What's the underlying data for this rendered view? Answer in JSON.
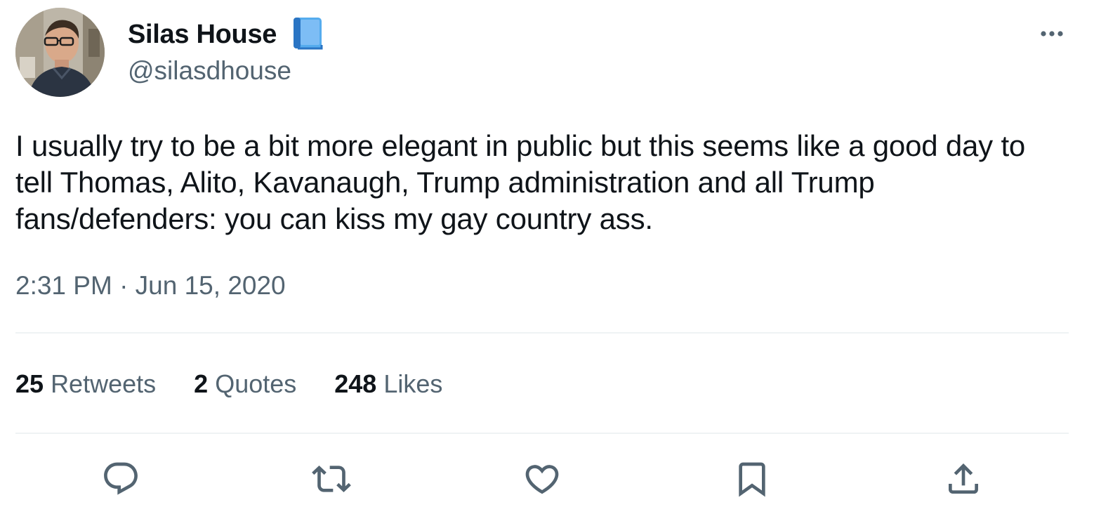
{
  "author": {
    "display_name": "Silas House",
    "handle": "@silasdhouse",
    "badge_icon": "blue-book-emoji",
    "avatar_icon": "profile-photo"
  },
  "tweet": {
    "text": "I usually try to be a bit more elegant in public but this seems like a good day to tell Thomas, Alito, Kavanaugh, Trump administration and all Trump fans/defenders: you can kiss my gay country ass.",
    "timestamp": "2:31 PM · Jun 15, 2020"
  },
  "stats": {
    "retweets": {
      "count": "25",
      "label": "Retweets"
    },
    "quotes": {
      "count": "2",
      "label": "Quotes"
    },
    "likes": {
      "count": "248",
      "label": "Likes"
    }
  },
  "actions": {
    "reply_icon": "reply-icon",
    "retweet_icon": "retweet-icon",
    "like_icon": "heart-icon",
    "bookmark_icon": "bookmark-icon",
    "share_icon": "share-icon",
    "more_icon": "more-icon"
  },
  "colors": {
    "text_primary": "#0f1419",
    "text_secondary": "#536471",
    "divider": "#eff3f4",
    "badge_blue": "#4a90e2"
  }
}
